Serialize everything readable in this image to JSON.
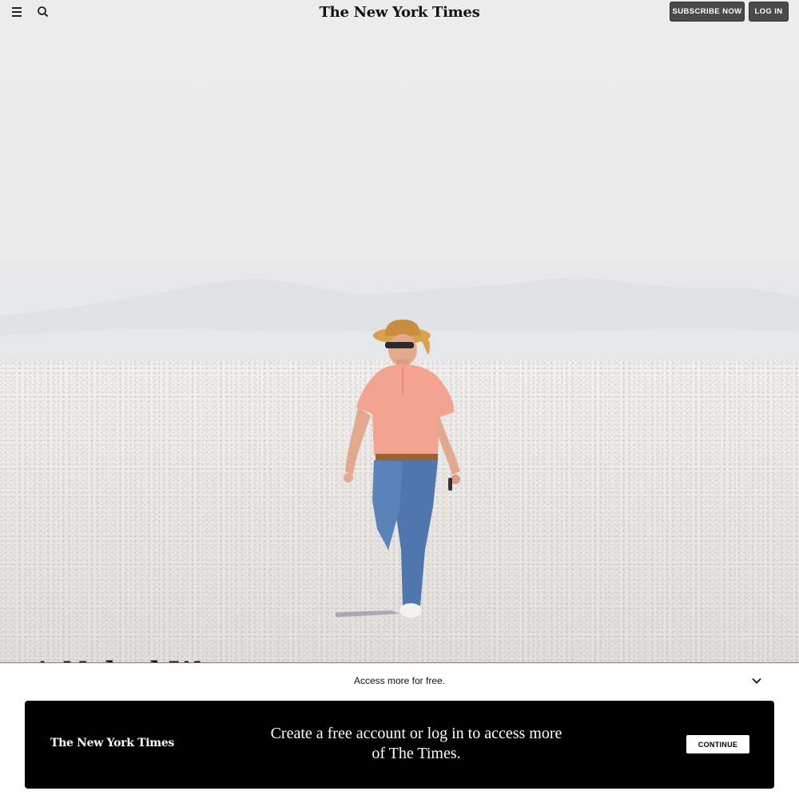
{
  "header": {
    "logo_text": "The New York Times",
    "menu_icon": "hamburger-menu-icon",
    "search_icon": "search-icon",
    "subscribe_label": "SUBSCRIBE NOW",
    "login_label": "LOG IN"
  },
  "hero": {
    "headline_partial": "A Naked Woman Fr"
  },
  "overlay": {
    "access_text": "Access more for free.",
    "collapse_icon": "chevron-down-icon",
    "card_logo_text": "The New York Times",
    "message": "Create a free account or log in to access more of The Times.",
    "continue_label": "CONTINUE"
  },
  "colors": {
    "header_button_bg": "#4a4a4a",
    "card_bg": "#000000",
    "continue_bg": "#ffffff"
  }
}
